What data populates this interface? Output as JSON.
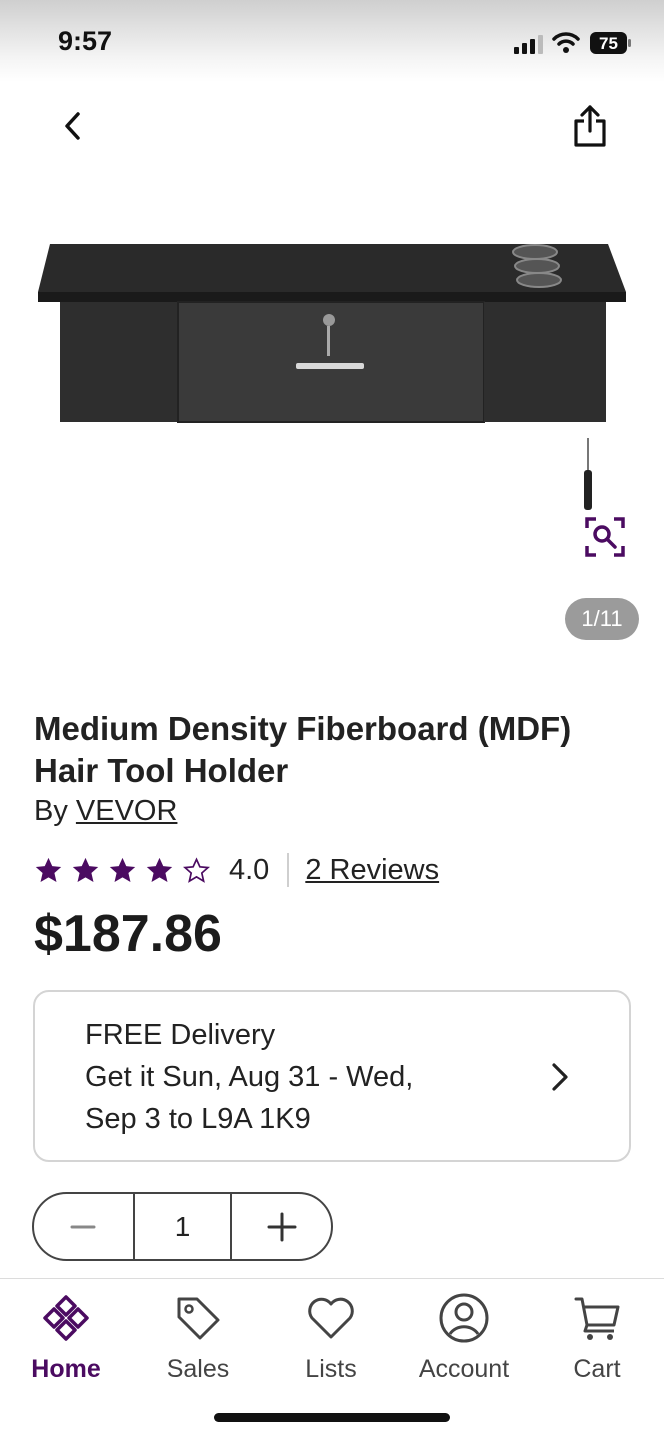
{
  "status_bar": {
    "time": "9:57",
    "battery": "75"
  },
  "colors": {
    "brand_purple": "#4b0b61",
    "counter_bg": "#9b9b9b",
    "text": "#222222"
  },
  "nav": {
    "back_icon": "chevron-left-icon",
    "share_icon": "share-icon"
  },
  "gallery": {
    "counter": "1/11",
    "zoom_icon": "zoom-search-icon"
  },
  "product": {
    "title": "Medium Density Fiberboard (MDF) Hair Tool Holder",
    "by_prefix": "By",
    "brand": "VEVOR",
    "rating": 4,
    "rating_text": "4.0",
    "reviews_text": "2 Reviews",
    "price": "$187.86"
  },
  "delivery": {
    "line1": "FREE Delivery",
    "line2": "Get it Sun, Aug 31 - Wed,",
    "line3": "Sep 3 to L9A 1K9"
  },
  "quantity": {
    "value": "1",
    "minus_icon": "minus-icon",
    "plus_icon": "plus-icon"
  },
  "tabs": [
    {
      "label": "Home",
      "icon": "home-logo-icon",
      "active": true
    },
    {
      "label": "Sales",
      "icon": "tag-icon",
      "active": false
    },
    {
      "label": "Lists",
      "icon": "heart-icon",
      "active": false
    },
    {
      "label": "Account",
      "icon": "account-icon",
      "active": false
    },
    {
      "label": "Cart",
      "icon": "cart-icon",
      "active": false
    }
  ]
}
